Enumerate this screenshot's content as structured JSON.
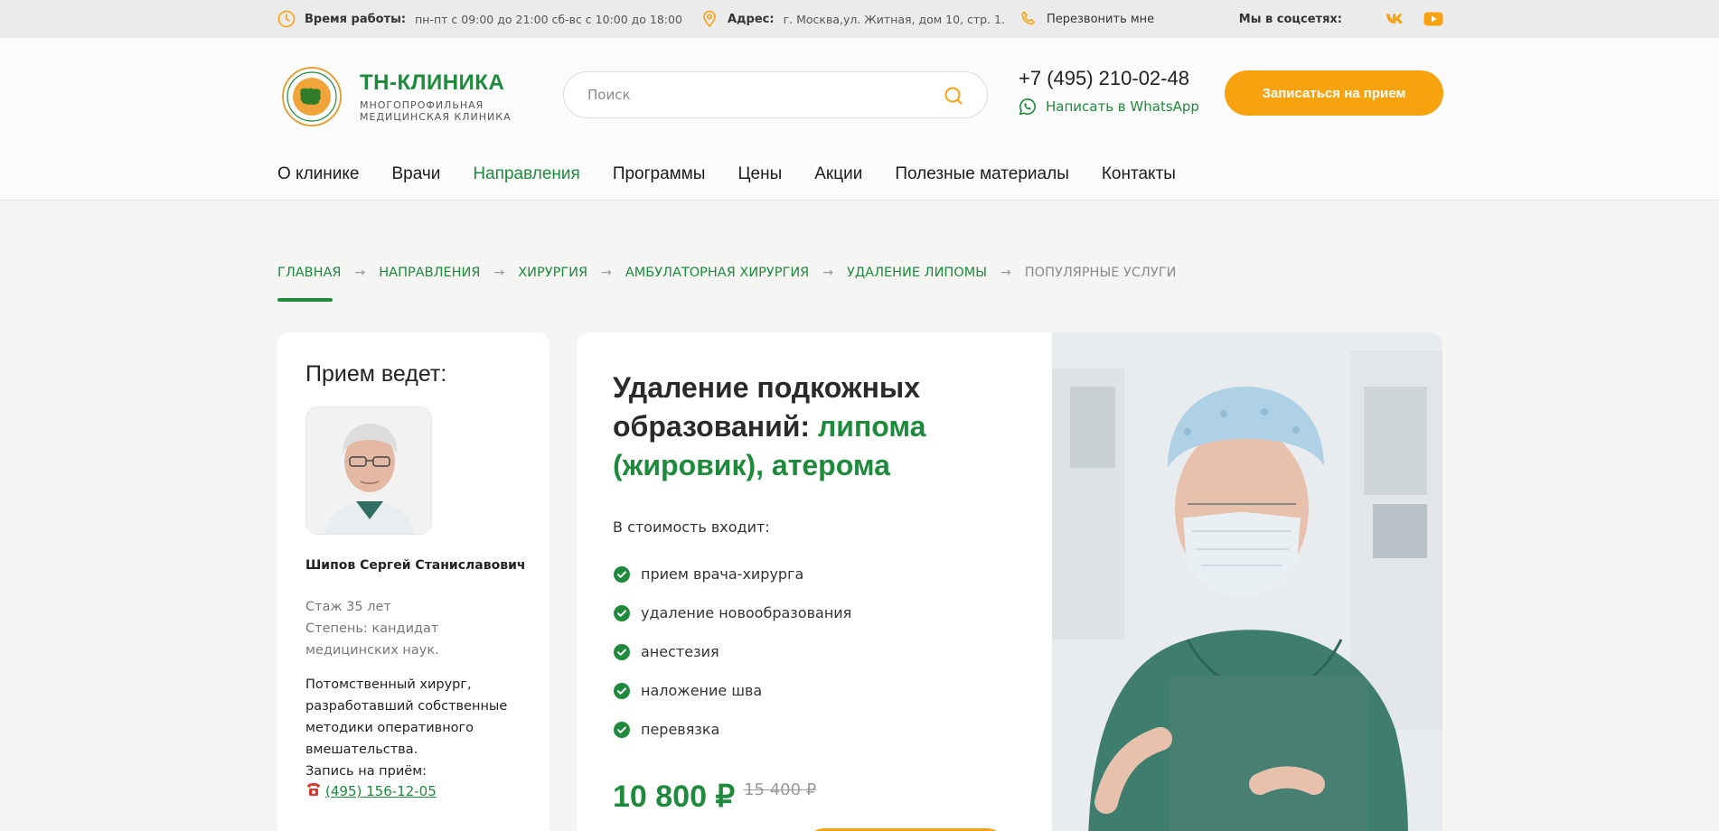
{
  "topbar": {
    "hours_label": "Время работы:",
    "hours_value": "пн-пт с 09:00 до 21:00 сб-вс с 10:00 до 18:00",
    "address_label": "Адрес:",
    "address_value": "г. Москва,ул. Житная, дом 10, стр. 1.",
    "callback": "Перезвонить мне",
    "social_label": "Мы в соцсетях:",
    "accent": "#f7a20f"
  },
  "header": {
    "logo_name": "ТН-КЛИНИКА",
    "logo_sub1": "многопрофильная",
    "logo_sub2": "медицинская клиника",
    "search_placeholder": "Поиск",
    "phone": "+7 (495) 210-02-48",
    "whatsapp": "Написать в WhatsApp",
    "cta": "Записаться на прием"
  },
  "nav": [
    {
      "label": "О клинике"
    },
    {
      "label": "Врачи"
    },
    {
      "label": "Направления"
    },
    {
      "label": "Программы"
    },
    {
      "label": "Цены"
    },
    {
      "label": "Акции"
    },
    {
      "label": "Полезные материалы"
    },
    {
      "label": "Контакты"
    }
  ],
  "breadcrumbs": [
    "Главная",
    "Направления",
    "Хирургия",
    "Амбулаторная хирургия",
    "Удаление липомы",
    "Популярные услуги"
  ],
  "doctor": {
    "title": "Прием ведет:",
    "name": "Шипов Сергей Станиславович",
    "experience": "Стаж 35 лет",
    "degree": "Степень: кандидат медицинских наук.",
    "description": "Потомственный хирург, разработавший собственные методики оперативного вмешательства.",
    "booking_label": "Запись на приём:",
    "phone": "(495) 156-12-05"
  },
  "service": {
    "title_plain": "Удаление подкожных образований: ",
    "title_accent": "липома (жировик), атерома",
    "includes_label": "В стоимость входит:",
    "items": [
      "прием врача-хирурга",
      "удаление новообразования",
      "анестезия",
      "наложение шва",
      "перевязка"
    ],
    "price": "10 800 ₽",
    "old_price": "15 400 ₽"
  },
  "colors": {
    "brand_green": "#1e8a3c",
    "brand_orange": "#f7a20f"
  }
}
